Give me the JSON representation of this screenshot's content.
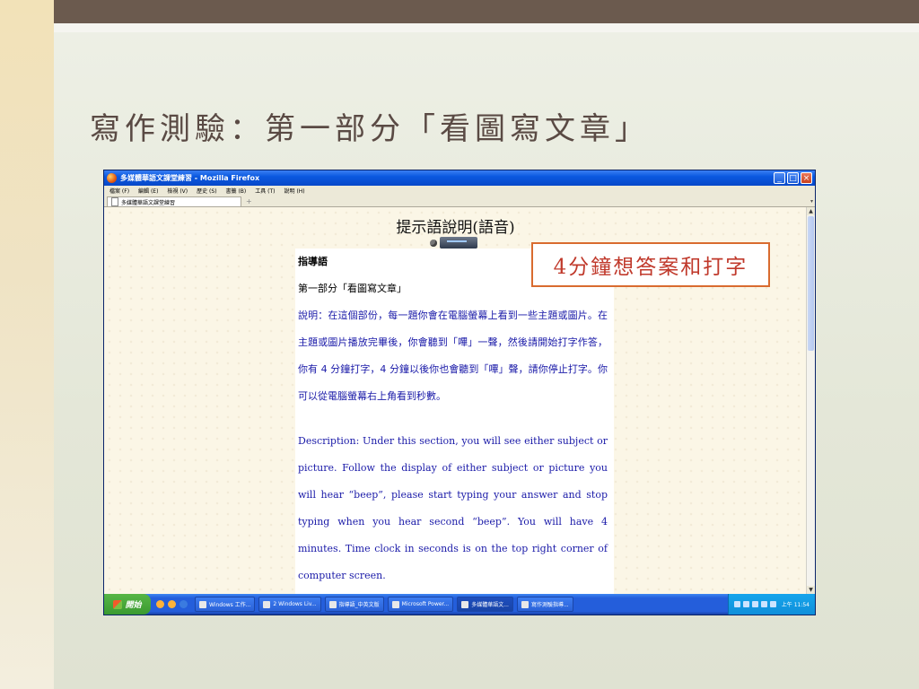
{
  "slide": {
    "title": "寫作測驗：第一部分「看圖寫文章」",
    "callout": "4分鐘想答案和打字",
    "colors": {
      "top_bar": "#6b5a4e",
      "title_text": "#5a4a44",
      "callout_border": "#d96b2f",
      "callout_text": "#c0392b"
    }
  },
  "browser": {
    "window_title": "多媒體華語文課堂練習 - Mozilla Firefox",
    "window_buttons": [
      "minimize",
      "maximize",
      "close"
    ],
    "menu": [
      "檔案 (F)",
      "編輯 (E)",
      "檢視 (V)",
      "歷史 (S)",
      "書籤 (B)",
      "工具 (T)",
      "說明 (H)"
    ],
    "tab_label": "多媒體華語文課堂練習",
    "new_tab": "+",
    "page": {
      "heading": "提示語說明(語音)",
      "instructions": {
        "heading": "指導語",
        "subtitle": "第一部分「看圖寫文章」",
        "zh": "說明：在這個部份，每一題你會在電腦螢幕上看到一些主題或圖片。在主題或圖片播放完畢後，你會聽到「嗶」一聲，然後請開始打字作答，你有 4 分鐘打字，4 分鐘以後你也會聽到「嗶」聲，請你停止打字。你可以從電腦螢幕右上角看到秒數。",
        "en": "Description: Under this section, you will see either subject or picture. Follow the display of either subject or picture you will hear “beep”, please start typing your answer and stop typing when you hear second “beep”. You will have 4 minutes. Time clock in seconds is on the top right corner of computer screen."
      }
    }
  },
  "taskbar": {
    "start": "開始",
    "items": [
      "Windows 工作...",
      "2 Windows Liv...",
      "指導語_中英文版",
      "Microsoft Power...",
      "多媒體華語文...",
      "寫作測驗指導..."
    ],
    "clock": "上午 11:54"
  }
}
